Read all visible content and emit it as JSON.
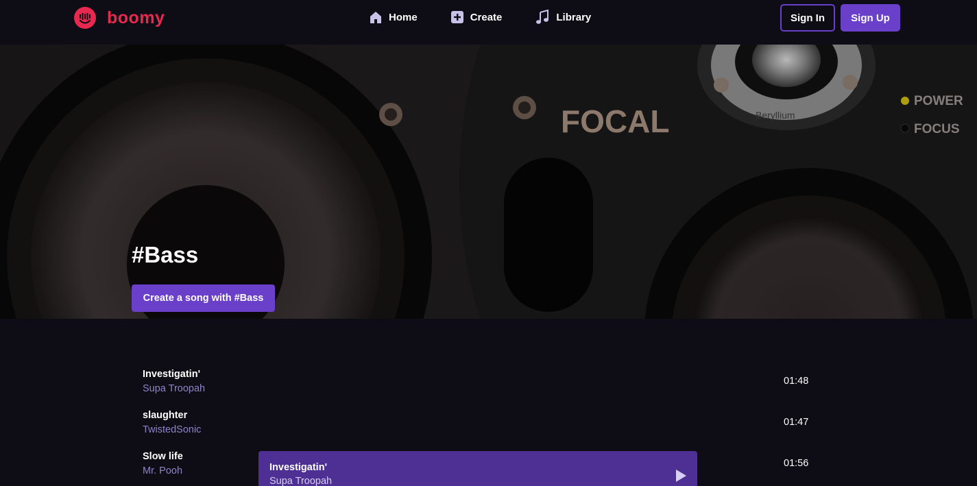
{
  "brand": {
    "name": "boomy",
    "color": "#e8294f",
    "icon": "smiley-equalizer-icon"
  },
  "nav": {
    "items": [
      {
        "label": "Home",
        "icon": "home-icon"
      },
      {
        "label": "Create",
        "icon": "plus-square-icon"
      },
      {
        "label": "Library",
        "icon": "music-note-icon"
      }
    ]
  },
  "auth": {
    "signin_label": "Sign In",
    "signup_label": "Sign Up"
  },
  "hero": {
    "title": "#Bass",
    "cta_label": "Create a song with #Bass",
    "image_text": {
      "brand": "FOCAL",
      "tweeter": "Beryllium",
      "power": "POWER",
      "focus": "FOCUS"
    }
  },
  "songs": [
    {
      "title": "Investigatin'",
      "artist": "Supa Troopah",
      "duration": "01:48"
    },
    {
      "title": "slaughter",
      "artist": "TwistedSonic",
      "duration": "01:47"
    },
    {
      "title": "Slow life",
      "artist": "Mr. Pooh",
      "duration": "01:56"
    }
  ],
  "player": {
    "title": "Investigatin'",
    "artist": "Supa Troopah",
    "icon": "play-icon"
  },
  "colors": {
    "accent": "#6a3fc9",
    "background": "#0e0c14",
    "artist_text": "#8f84c9",
    "player_bg": "#4e2f94"
  }
}
